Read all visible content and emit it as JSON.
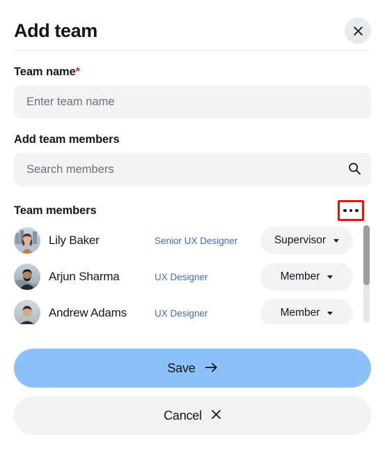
{
  "dialog": {
    "title": "Add team",
    "close_icon": "close-icon"
  },
  "form": {
    "team_name_label": "Team name",
    "required_marker": "*",
    "team_name_value": "",
    "team_name_placeholder": "Enter team name",
    "add_members_label": "Add team members",
    "search_value": "",
    "search_placeholder": "Search members",
    "search_icon": "search-icon"
  },
  "members_section": {
    "heading": "Team members",
    "more_icon": "ellipsis-icon",
    "more_button_highlighted": true,
    "highlight_color": "#f60a0a",
    "members": [
      {
        "name": "Lily Baker",
        "title": "Senior UX Designer",
        "role": "Supervisor",
        "avatar": "avatar-photo-woman-city"
      },
      {
        "name": "Arjun Sharma",
        "title": "UX Designer",
        "role": "Member",
        "avatar": "avatar-photo-man-beard"
      },
      {
        "name": "Andrew Adams",
        "title": "UX Designer",
        "role": "Member",
        "avatar": "avatar-photo-man-short-hair"
      }
    ]
  },
  "footer": {
    "save_label": "Save",
    "save_icon": "arrow-right-icon",
    "cancel_label": "Cancel",
    "cancel_icon": "close-x-icon"
  },
  "colors": {
    "save_button": "#8cc2f9",
    "cancel_button": "#f2f2f3",
    "input_background": "#f3f3f4",
    "title_link": "#3f6cb4",
    "required_asterisk": "#d32d2d",
    "highlight_box": "#f60a0a"
  }
}
